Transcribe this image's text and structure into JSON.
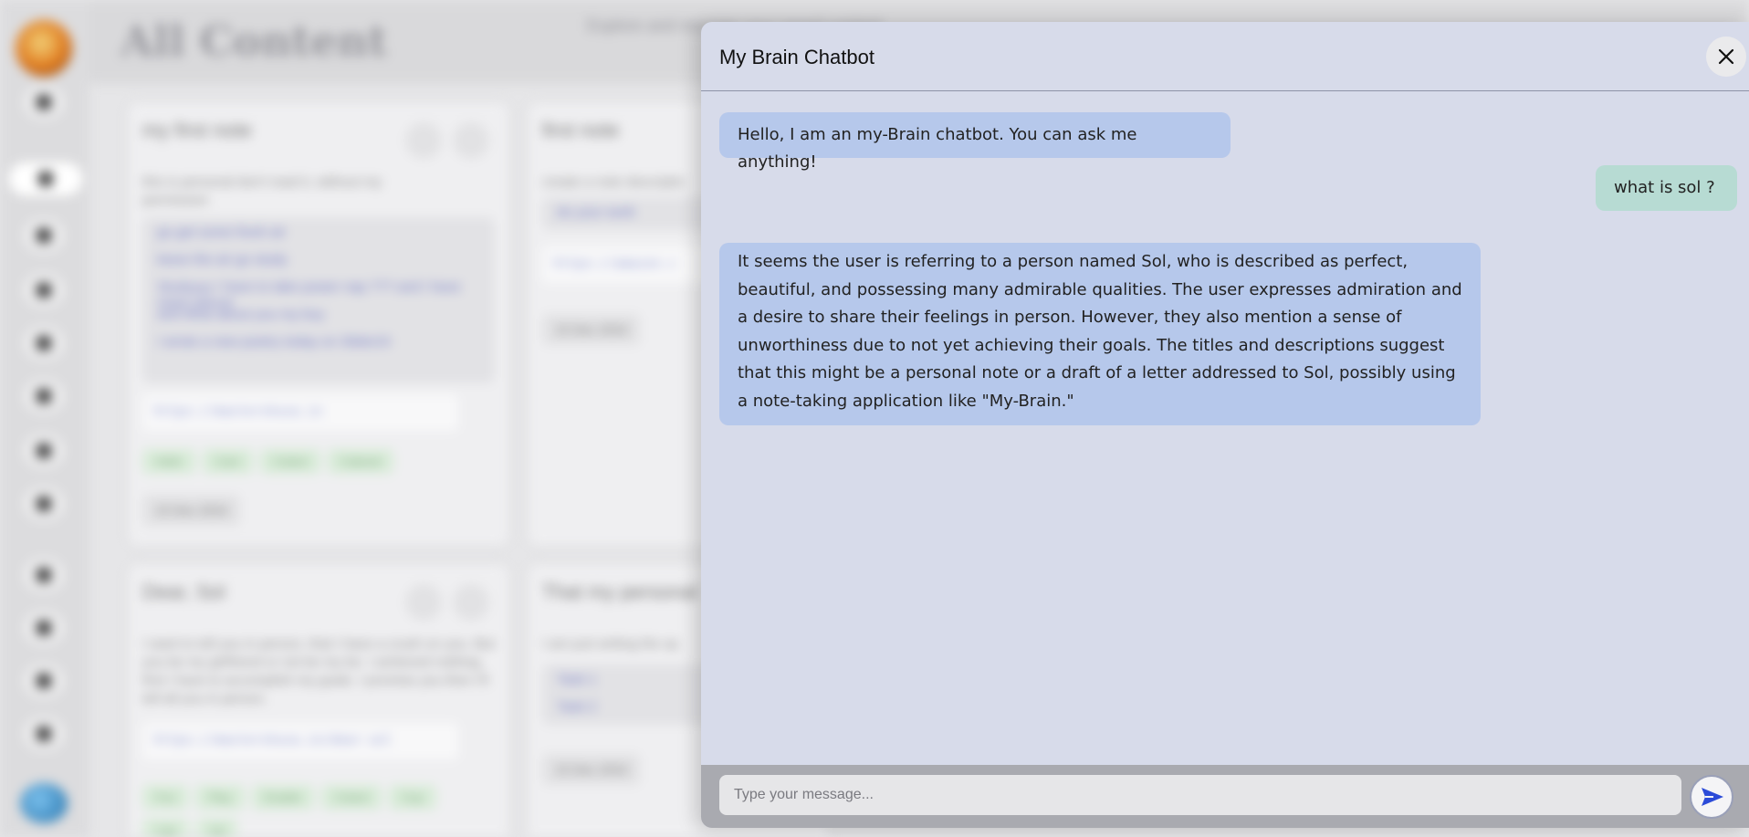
{
  "background": {
    "page_title": "All Content",
    "subtitle": "Explore and manage your saved content",
    "cards": [
      {
        "title": "my first note",
        "text": "this is personal don't read it, without my permission",
        "list": [
          "go get some fresh air",
          "leave the air go study",
          "Studyyyy I have to take power nap ??? and I have many pieces",
          "and what about you my boy",
          "I wrote a new poetry today on Slider24"
        ],
        "url": "https://mastershuva.in",
        "tags": [
          "Hello",
          "Cam",
          "Cotest",
          "Cateset"
        ],
        "date": "15 Dec 2024"
      },
      {
        "title": "first note",
        "text": "create a note descriptio",
        "list": [
          "do your work"
        ],
        "url": "https://amazon.c",
        "date": "15 Dec 2024"
      },
      {
        "title": "Dear, Sol",
        "text": "I want to tell you in person, that I have a crush on you. But you be my girlfriend or not be my be. I achieved nothing, first I have to accomplish my goals. I promise you then I'll tell all you in person.",
        "url": "https://mastershuva.in/dear-sol",
        "tags": [
          "Fun",
          "Play",
          "Enable",
          "Cotest",
          "Cup",
          "Cak",
          "Gd"
        ]
      },
      {
        "title": "That my personal",
        "text": "I am just writing the sp",
        "list": [
          "Task 1",
          "Task 2"
        ],
        "date": "15 Dec 2024"
      }
    ]
  },
  "chatbot": {
    "title": "My Brain Chatbot",
    "messages": [
      {
        "role": "bot",
        "text": "Hello, I am an my-Brain chatbot. You can ask me anything!"
      },
      {
        "role": "user",
        "text": "what is sol ?"
      },
      {
        "role": "bot",
        "text": "It seems the user is referring to a person named Sol, who is described as perfect, beautiful, and possessing many admirable qualities. The user expresses admiration and a desire to share their feelings in person. However, they also mention a sense of unworthiness due to not yet achieving their goals. The titles and descriptions suggest that this might be a personal note or a draft of a letter addressed to Sol, possibly using a note-taking application like \"My-Brain.\""
      }
    ],
    "input": {
      "placeholder": "Type your message...",
      "value": ""
    },
    "icons": {
      "close": "close-icon",
      "send": "send-icon"
    },
    "colors": {
      "panel": "#d7dbea",
      "bot_bubble": "#b6c8eb",
      "user_bubble": "#b7dbd3",
      "send": "#2b4bd8"
    }
  }
}
